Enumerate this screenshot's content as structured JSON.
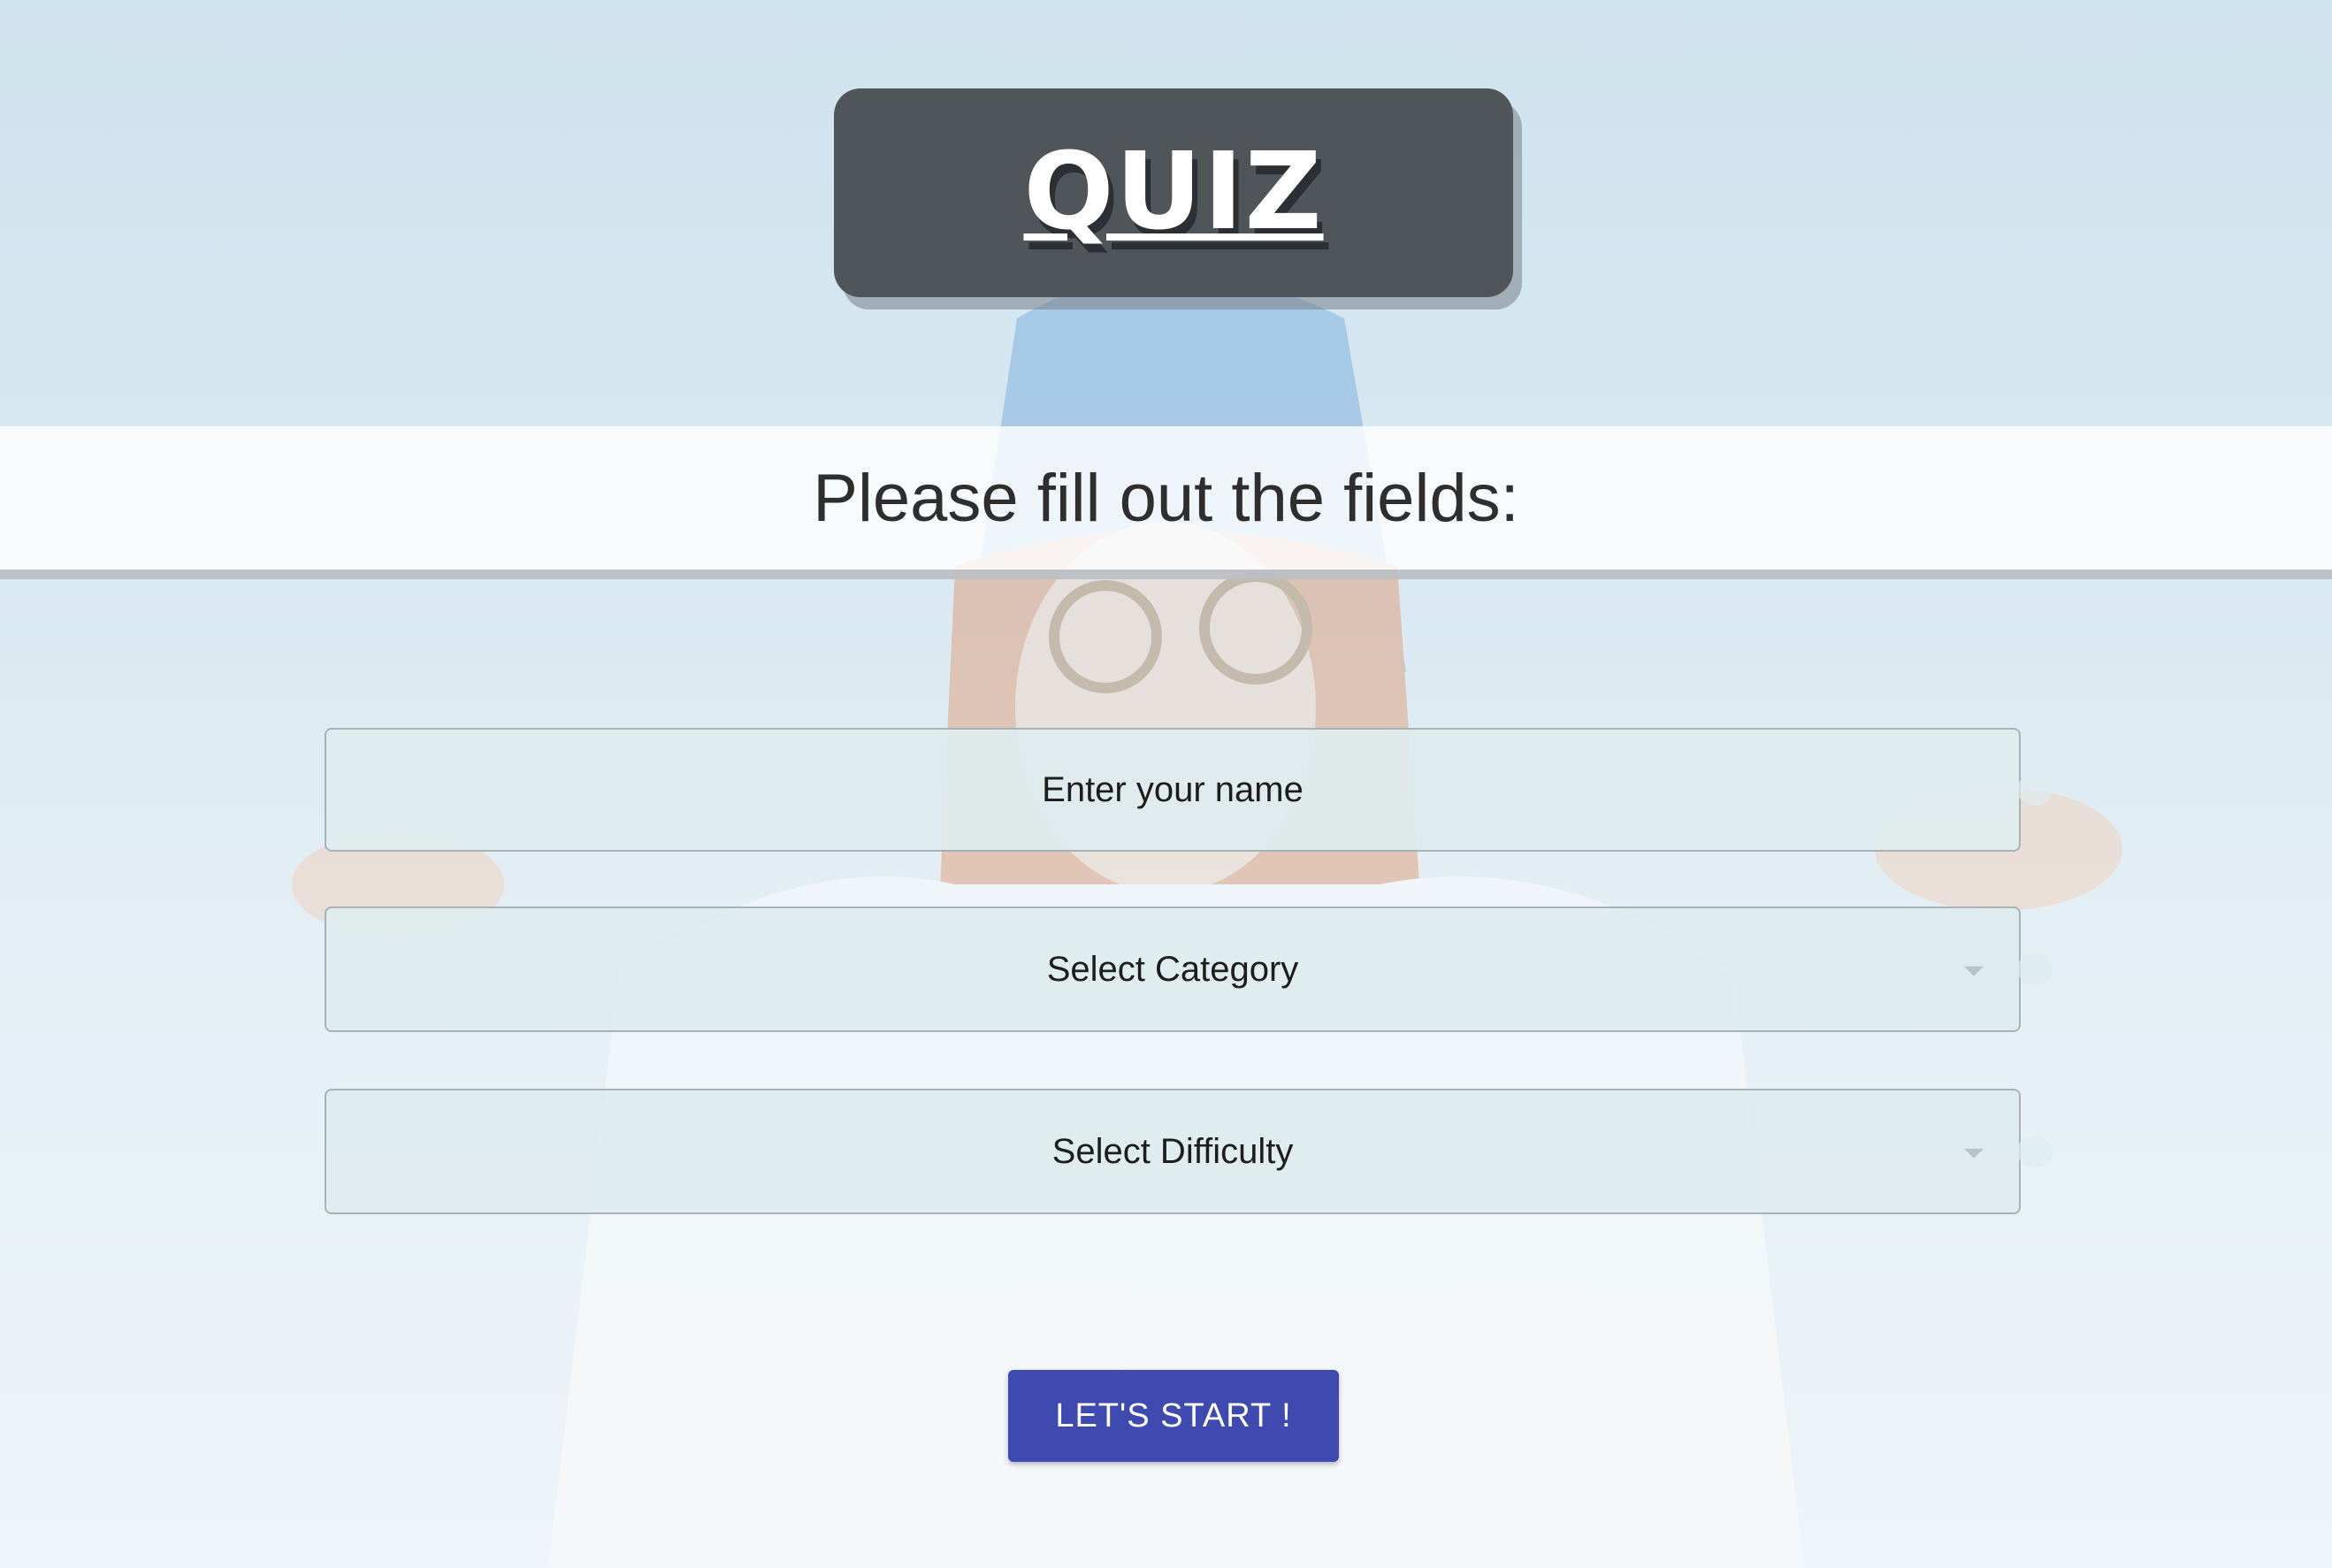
{
  "header": {
    "title": "QUIZ"
  },
  "banner": {
    "text": "Please fill out the fields:"
  },
  "form": {
    "name_placeholder": "Enter your name",
    "category_label": "Select Category",
    "difficulty_label": "Select Difficulty",
    "start_label": "LET'S START !"
  },
  "colors": {
    "title_box": "#50555a",
    "button": "#3f4ab1",
    "field_bg": "#deecee"
  }
}
